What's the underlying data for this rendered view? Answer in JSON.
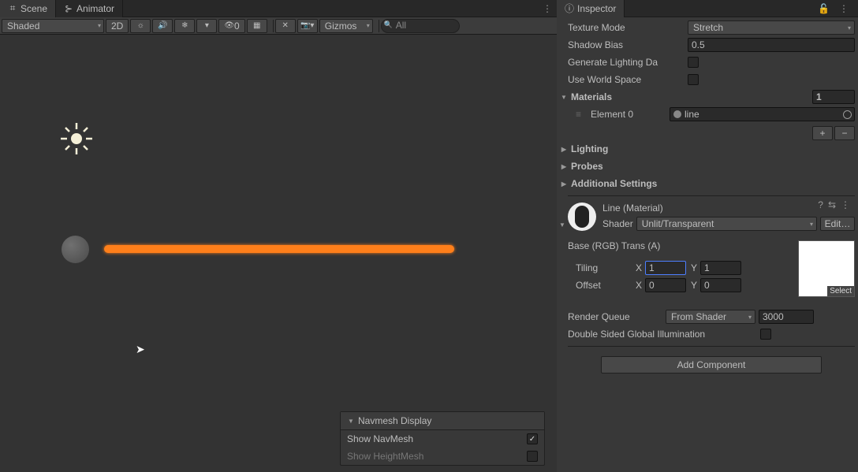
{
  "scene": {
    "tabs": {
      "scene": "Scene",
      "animator": "Animator"
    },
    "toolbar": {
      "shading_mode": "Shaded",
      "mode_2d": "2D",
      "gizmos": "Gizmos",
      "search_placeholder": "All",
      "fx_count": "0"
    },
    "navmesh": {
      "title": "Navmesh Display",
      "show_navmesh_label": "Show NavMesh",
      "show_heightmesh_label": "Show HeightMesh"
    }
  },
  "inspector": {
    "tab": "Inspector",
    "texture_mode": {
      "label": "Texture Mode",
      "value": "Stretch"
    },
    "shadow_bias": {
      "label": "Shadow Bias",
      "value": "0.5"
    },
    "generate_lighting": {
      "label": "Generate Lighting Da"
    },
    "use_world_space": {
      "label": "Use World Space"
    },
    "materials": {
      "header": "Materials",
      "count": "1",
      "element_label": "Element 0",
      "element_value": "line"
    },
    "lighting": "Lighting",
    "probes": "Probes",
    "additional": "Additional Settings",
    "material": {
      "name": "Line (Material)",
      "shader_label": "Shader",
      "shader_value": "Unlit/Transparent",
      "edit": "Edit…",
      "base_label": "Base (RGB) Trans (A)",
      "tiling_label": "Tiling",
      "tiling_x": "1",
      "tiling_y": "1",
      "offset_label": "Offset",
      "offset_x": "0",
      "offset_y": "0",
      "texture_select": "Select",
      "render_queue_label": "Render Queue",
      "render_queue_mode": "From Shader",
      "render_queue_value": "3000",
      "double_sided": "Double Sided Global Illumination"
    },
    "add_component": "Add Component"
  }
}
